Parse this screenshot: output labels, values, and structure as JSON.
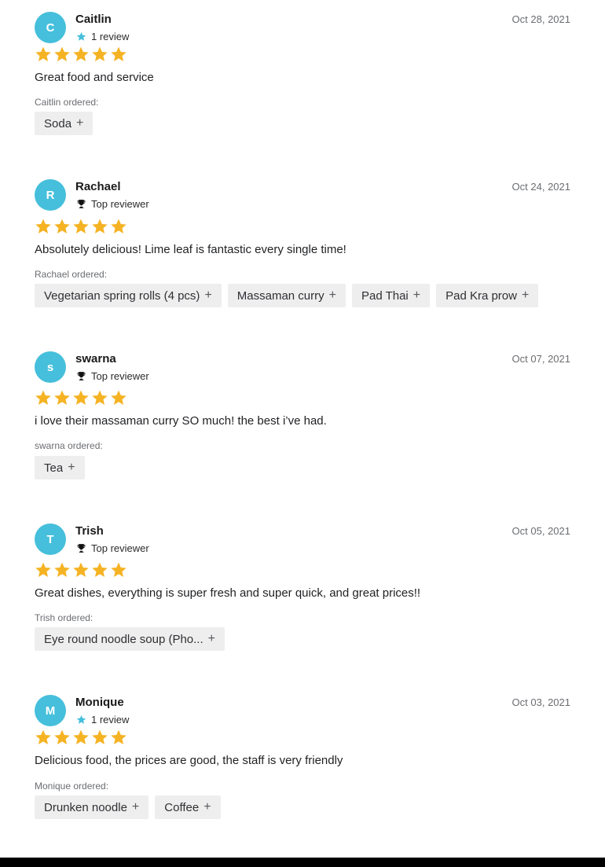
{
  "reviews": [
    {
      "initial": "C",
      "name": "Caitlin",
      "badge_type": "star",
      "badge_label": "1 review",
      "date": "Oct 28, 2021",
      "rating": 5,
      "comment": "Great food and service",
      "ordered_label": "Caitlin ordered:",
      "items": [
        "Soda"
      ]
    },
    {
      "initial": "R",
      "name": "Rachael",
      "badge_type": "trophy",
      "badge_label": "Top reviewer",
      "date": "Oct 24, 2021",
      "rating": 5,
      "comment": "Absolutely delicious! Lime leaf is fantastic every single time!",
      "ordered_label": "Rachael ordered:",
      "items": [
        "Vegetarian spring rolls (4 pcs)",
        "Massaman curry",
        "Pad Thai",
        "Pad Kra prow"
      ]
    },
    {
      "initial": "s",
      "name": "swarna",
      "badge_type": "trophy",
      "badge_label": "Top reviewer",
      "date": "Oct 07, 2021",
      "rating": 5,
      "comment": "i love their massaman curry SO much! the best i’ve had.",
      "ordered_label": "swarna ordered:",
      "items": [
        "Tea"
      ]
    },
    {
      "initial": "T",
      "name": "Trish",
      "badge_type": "trophy",
      "badge_label": "Top reviewer",
      "date": "Oct 05, 2021",
      "rating": 5,
      "comment": "Great dishes, everything is super fresh and super quick, and great prices!!",
      "ordered_label": "Trish ordered:",
      "items": [
        "Eye round noodle soup (Pho..."
      ]
    },
    {
      "initial": "M",
      "name": "Monique",
      "badge_type": "star",
      "badge_label": "1 review",
      "date": "Oct 03, 2021",
      "rating": 5,
      "comment": "Delicious food, the prices are good, the staff is very friendly",
      "ordered_label": "Monique ordered:",
      "items": [
        "Drunken noodle",
        "Coffee"
      ]
    }
  ],
  "plus_symbol": "+",
  "colors": {
    "avatar": "#45bfdb",
    "star": "#f5b324",
    "badge_star": "#45bfdb",
    "chip_bg": "#eeeeef"
  }
}
